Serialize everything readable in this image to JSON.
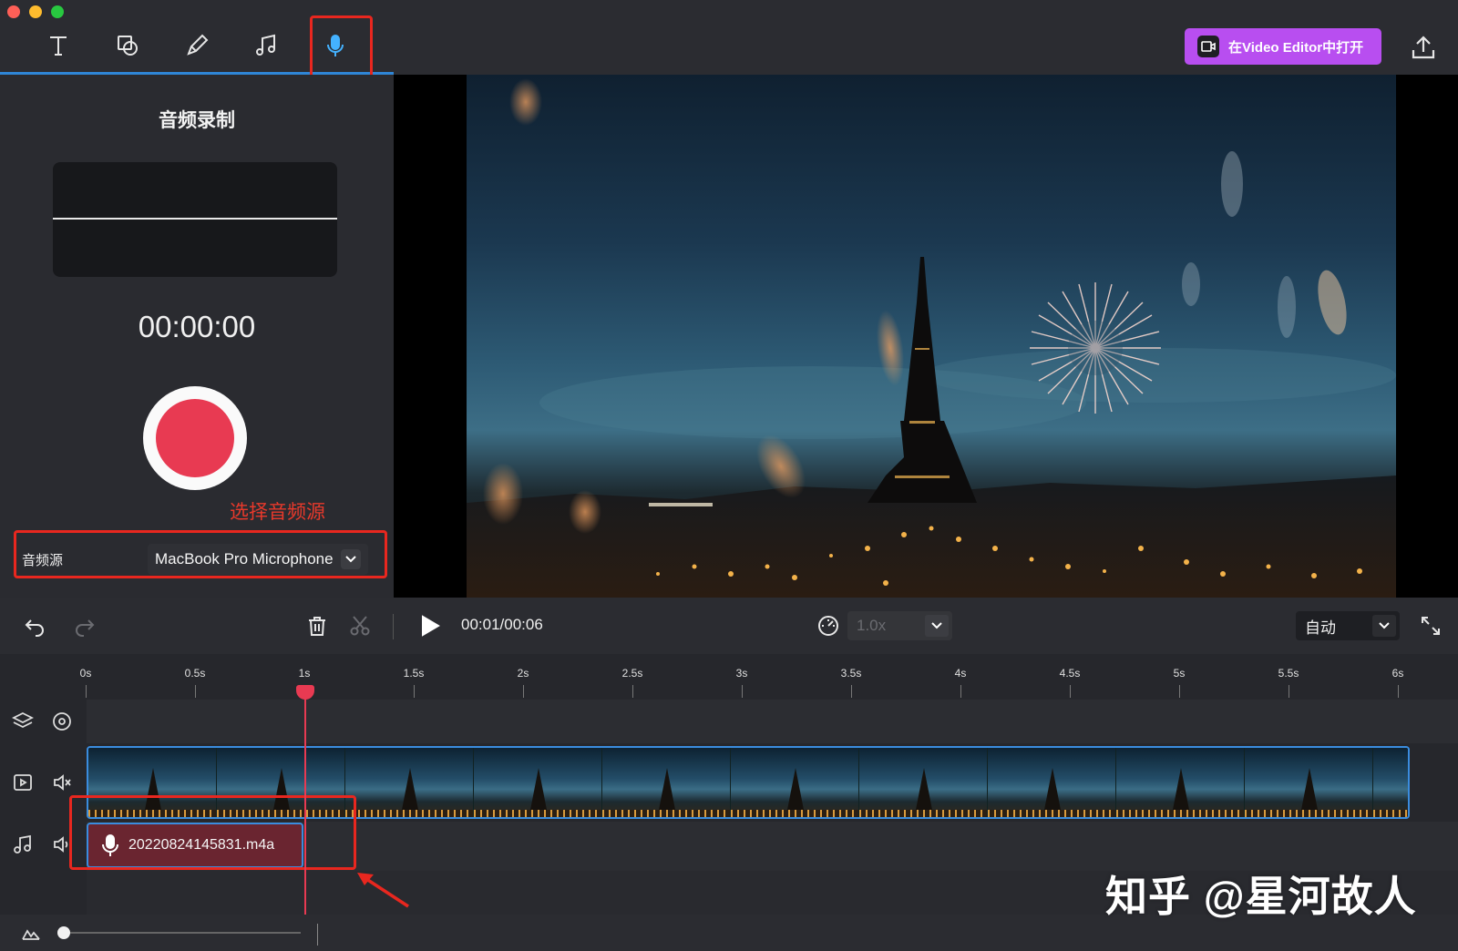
{
  "toolbar": {
    "tools": [
      "text-tool",
      "shape-tool",
      "pen-tool",
      "music-tool",
      "microphone-tool"
    ],
    "active_tool": "microphone-tool",
    "open_button_label": "在Video Editor中打开"
  },
  "record_panel": {
    "title": "音频录制",
    "timer": "00:00:00",
    "annotation": "选择音频源",
    "source_label": "音频源",
    "source_value": "MacBook Pro Microphone"
  },
  "playback": {
    "time": "00:01/00:06",
    "speed": "1.0x",
    "zoom_mode": "自动"
  },
  "ruler": {
    "labels": [
      "0s",
      "0.5s",
      "1s",
      "1.5s",
      "2s",
      "2.5s",
      "3s",
      "3.5s",
      "4s",
      "4.5s",
      "5s",
      "5.5s",
      "6s"
    ]
  },
  "timeline": {
    "audio_clip_name": "20220824145831.m4a",
    "video_thumbnail_count": 11,
    "playhead_seconds": 1
  },
  "watermark": "知乎 @星河故人",
  "colors": {
    "accent_blue": "#2f86d6",
    "record_red": "#e83a52",
    "annotation_red": "#e8271f",
    "open_button_purple": "#b84ef0"
  }
}
